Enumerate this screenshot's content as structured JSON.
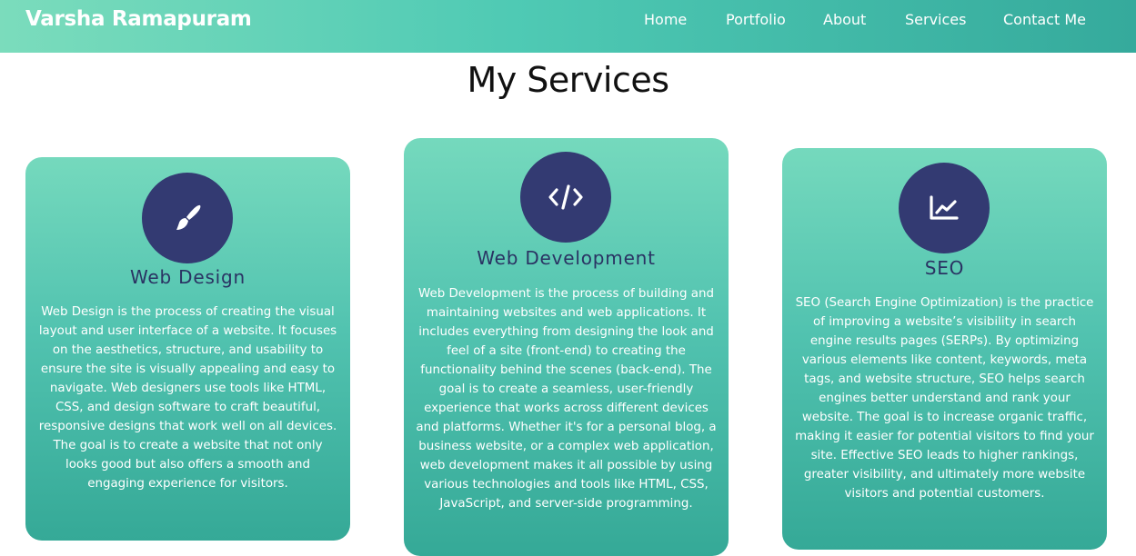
{
  "header": {
    "brand": "Varsha Ramapuram",
    "nav": [
      "Home",
      "Portfolio",
      "About",
      "Services",
      "Contact Me"
    ]
  },
  "page_title": "My Services",
  "services": [
    {
      "icon": "paint-brush-icon",
      "title": "Web Design",
      "description": "Web Design is the process of creating the visual layout and user interface of a website. It focuses on the aesthetics, structure, and usability to ensure the site is visually appealing and easy to navigate. Web designers use tools like HTML, CSS, and design software to craft beautiful, responsive designs that work well on all devices. The goal is to create a website that not only looks good but also offers a smooth and engaging experience for visitors."
    },
    {
      "icon": "code-icon",
      "title": "Web Development",
      "description": "Web Development is the process of building and maintaining websites and web applications. It includes everything from designing the look and feel of a site (front-end) to creating the functionality behind the scenes (back-end). The goal is to create a seamless, user-friendly experience that works across different devices and platforms. Whether it's for a personal blog, a business website, or a complex web application, web development makes it all possible by using various technologies and tools like HTML, CSS, JavaScript, and server-side programming."
    },
    {
      "icon": "chart-line-icon",
      "title": "SEO",
      "description": "SEO (Search Engine Optimization) is the practice of improving a website’s visibility in search engine results pages (SERPs). By optimizing various elements like content, keywords, meta tags, and website structure, SEO helps search engines better understand and rank your website. The goal is to increase organic traffic, making it easier for potential visitors to find your site. Effective SEO leads to higher rankings, greater visibility, and ultimately more website visitors and potential customers."
    }
  ],
  "colors": {
    "header_gradient_start": "#7bdcbc",
    "header_gradient_end": "#35aa9c",
    "card_gradient_start": "#75d9bd",
    "card_gradient_end": "#35a997",
    "icon_circle": "#333a72",
    "card_title": "#2a3363"
  }
}
